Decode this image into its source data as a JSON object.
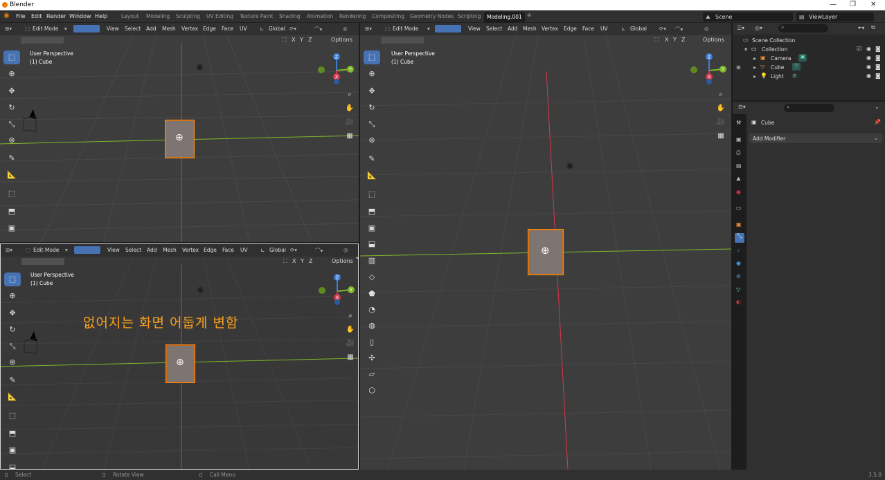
{
  "window": {
    "title": "Blender",
    "minimize": "—",
    "maximize": "❐",
    "close": "✕"
  },
  "menu": [
    "File",
    "Edit",
    "Render",
    "Window",
    "Help"
  ],
  "workspaces": [
    "Layout",
    "Modeling",
    "Sculpting",
    "UV Editing",
    "Texture Paint",
    "Shading",
    "Animation",
    "Rendering",
    "Compositing",
    "Geometry Nodes",
    "Scripting",
    "Modeling.001"
  ],
  "workspace_add": "+",
  "scene": "Scene",
  "view_layer": "ViewLayer",
  "viewport": {
    "mode": "Edit Mode",
    "menus": [
      "View",
      "Select",
      "Add",
      "Mesh",
      "Vertex",
      "Edge",
      "Face",
      "UV"
    ],
    "orientation": "Global",
    "xyz": [
      "X",
      "Y",
      "Z"
    ],
    "options": "Options",
    "perspective": "User Perspective",
    "object": "(1) Cube"
  },
  "gizmo": {
    "z": "Z",
    "x": "X",
    "y": "Y"
  },
  "annotation": "없어지는 화면 어둡게 변함",
  "outliner": {
    "root": "Scene Collection",
    "collection": "Collection",
    "items": [
      "Camera",
      "Cube",
      "Light"
    ]
  },
  "properties": {
    "object": "Cube",
    "add_modifier": "Add Modifier"
  },
  "status": {
    "select": "Select",
    "rotate": "Rotate View",
    "call_menu": "Call Menu",
    "version": "3.5.0"
  },
  "colors": {
    "accent": "#4772b3",
    "selection": "#f58c1e",
    "x_axis": "#d5384f",
    "y_axis": "#80b82a",
    "z_axis": "#3b7fd6"
  }
}
